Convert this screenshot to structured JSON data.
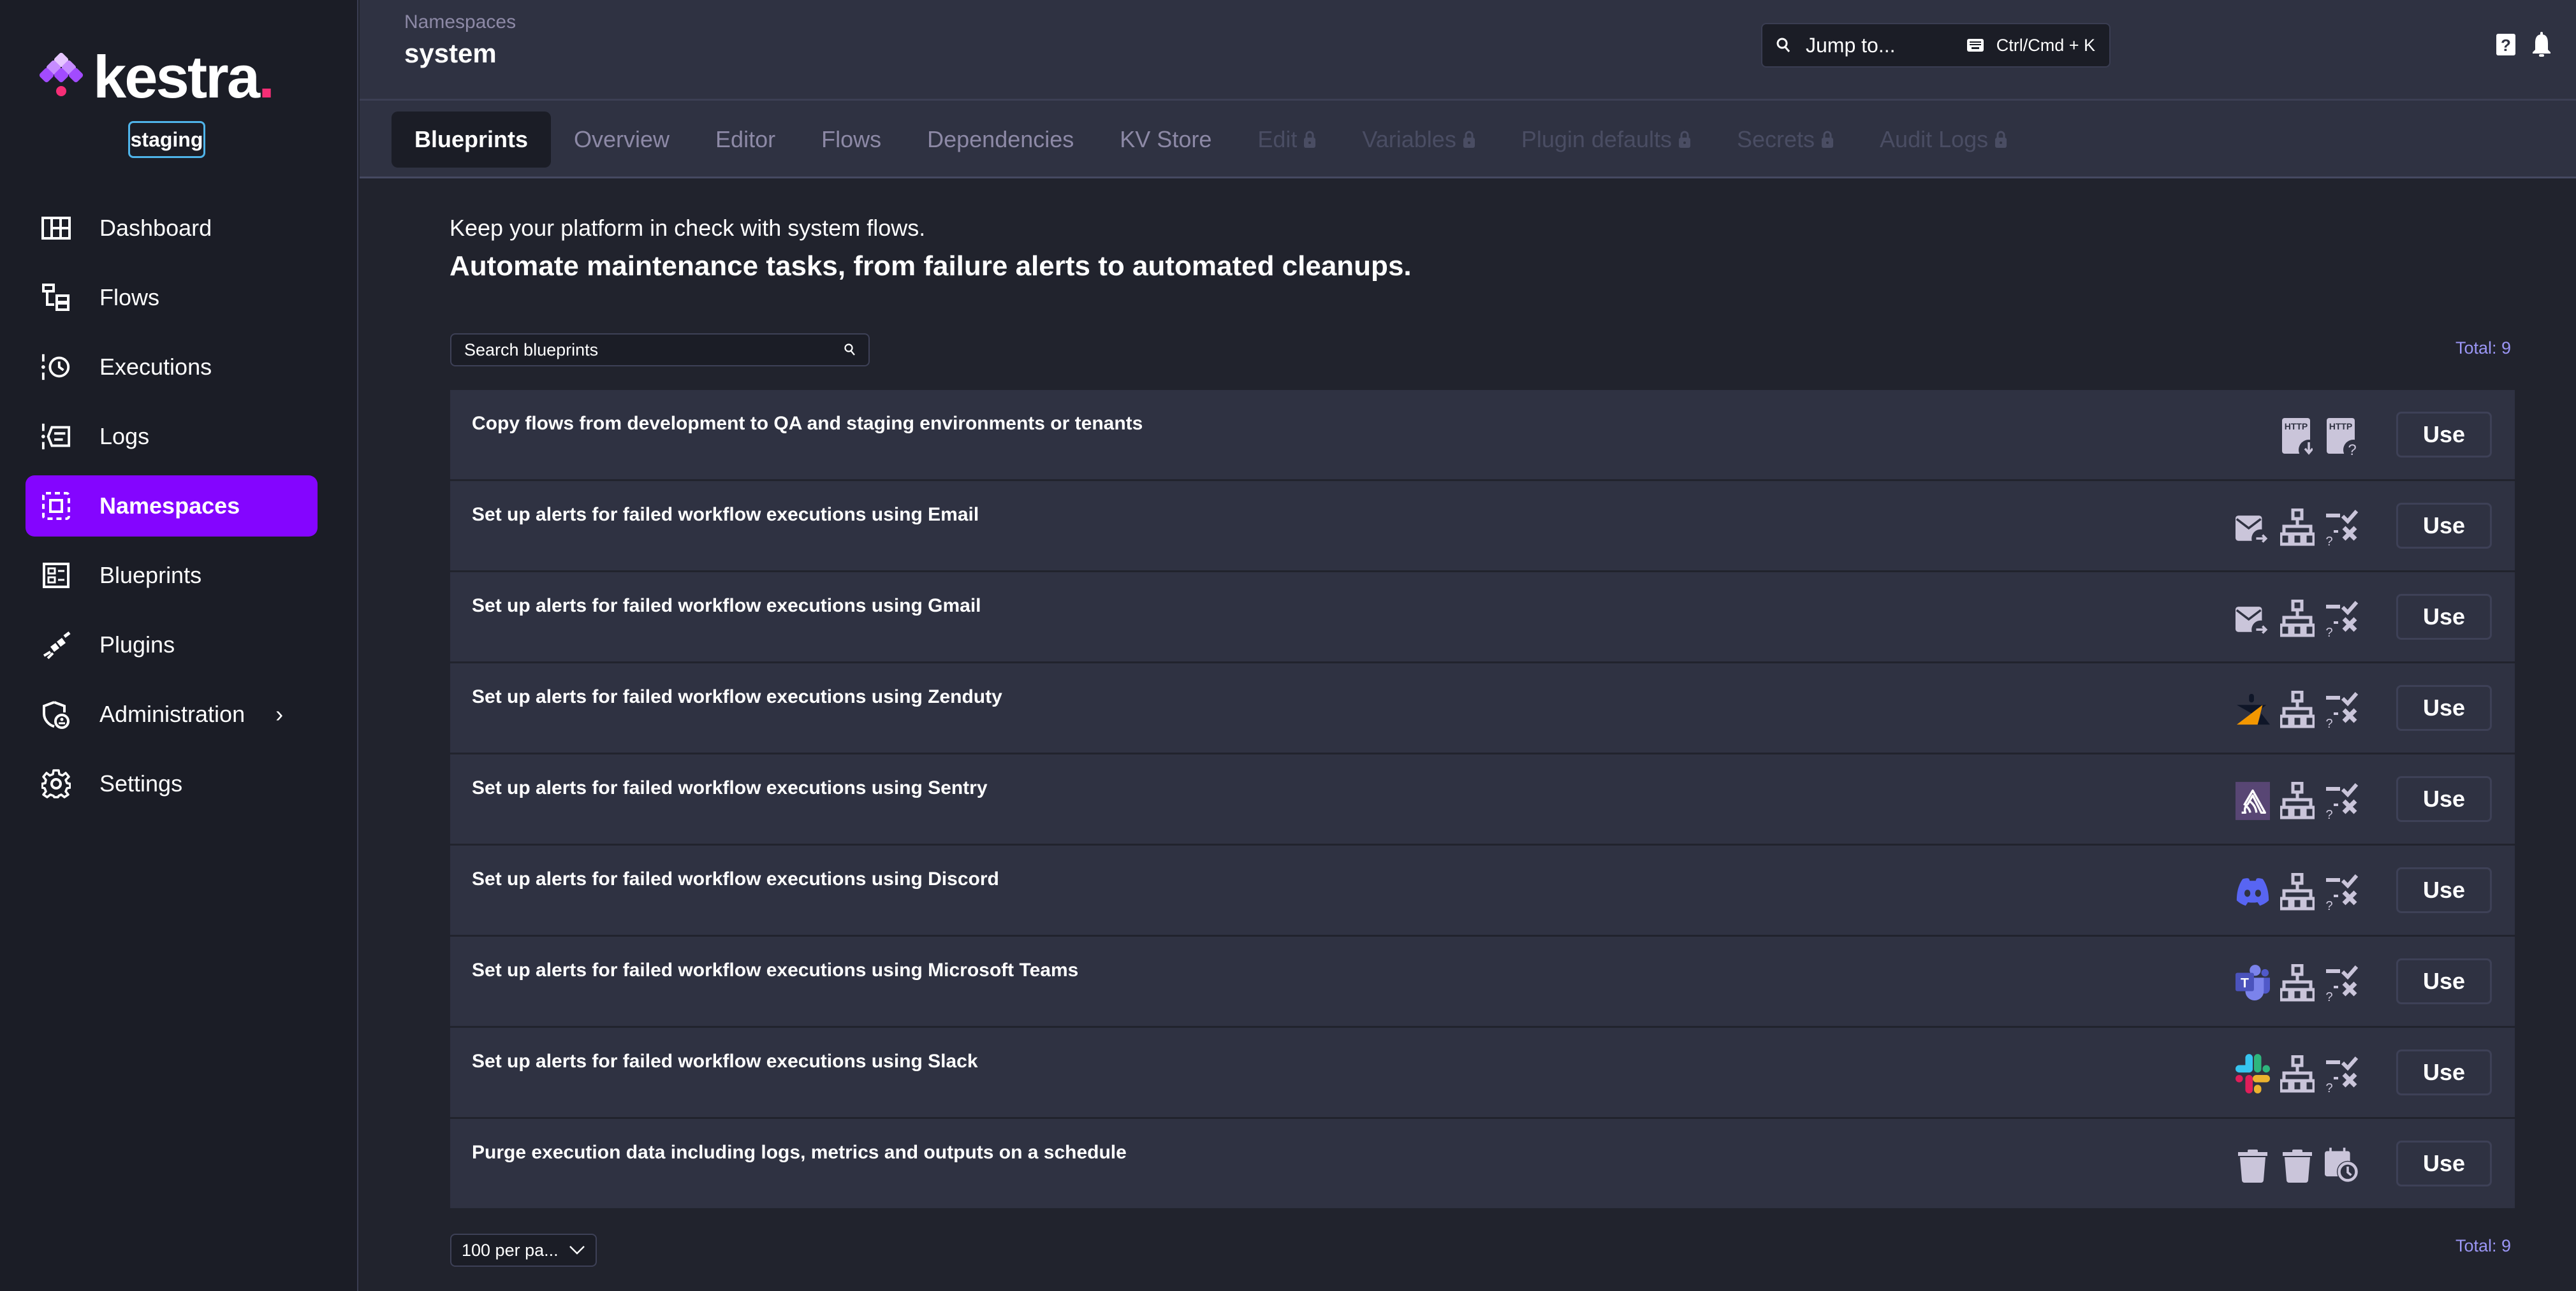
{
  "app": {
    "brand": "kestra",
    "environment": "staging"
  },
  "sidebar": {
    "items": [
      {
        "label": "Dashboard",
        "icon": "dashboard-icon"
      },
      {
        "label": "Flows",
        "icon": "flows-icon"
      },
      {
        "label": "Executions",
        "icon": "executions-icon"
      },
      {
        "label": "Logs",
        "icon": "logs-icon"
      },
      {
        "label": "Namespaces",
        "icon": "namespaces-icon",
        "active": true
      },
      {
        "label": "Blueprints",
        "icon": "blueprints-icon"
      },
      {
        "label": "Plugins",
        "icon": "plugins-icon"
      },
      {
        "label": "Administration",
        "icon": "administration-icon",
        "has_submenu": true
      },
      {
        "label": "Settings",
        "icon": "settings-icon"
      }
    ]
  },
  "header": {
    "breadcrumb": "Namespaces",
    "title": "system",
    "jump_to": {
      "placeholder": "Jump to...",
      "shortcut": "Ctrl/Cmd + K"
    },
    "icons": [
      "help-icon",
      "bell-icon"
    ]
  },
  "tabs": [
    {
      "label": "Blueprints",
      "active": true
    },
    {
      "label": "Overview"
    },
    {
      "label": "Editor"
    },
    {
      "label": "Flows"
    },
    {
      "label": "Dependencies"
    },
    {
      "label": "KV Store"
    },
    {
      "label": "Edit",
      "locked": true
    },
    {
      "label": "Variables",
      "locked": true
    },
    {
      "label": "Plugin defaults",
      "locked": true
    },
    {
      "label": "Secrets",
      "locked": true
    },
    {
      "label": "Audit Logs",
      "locked": true
    }
  ],
  "content": {
    "intro_line": "Keep your platform in check with system flows.",
    "headline": "Automate maintenance tasks, from failure alerts to automated cleanups.",
    "search_placeholder": "Search blueprints",
    "total_label": "Total: 9",
    "use_label": "Use",
    "page_size": "100 per pa..."
  },
  "blueprints": [
    {
      "title": "Copy flows from development to QA and staging environments or tenants",
      "icons": [
        "http-download-icon",
        "http-request-icon"
      ]
    },
    {
      "title": "Set up alerts for failed workflow executions using Email",
      "icons": [
        "email-send-icon",
        "flow-tree-icon",
        "flow-trigger-icon"
      ]
    },
    {
      "title": "Set up alerts for failed workflow executions using Gmail",
      "icons": [
        "email-send-icon",
        "flow-tree-icon",
        "flow-trigger-icon"
      ]
    },
    {
      "title": "Set up alerts for failed workflow executions using Zenduty",
      "icons": [
        "zenduty-icon",
        "flow-tree-icon",
        "flow-trigger-icon"
      ]
    },
    {
      "title": "Set up alerts for failed workflow executions using Sentry",
      "icons": [
        "sentry-icon",
        "flow-tree-icon",
        "flow-trigger-icon"
      ]
    },
    {
      "title": "Set up alerts for failed workflow executions using Discord",
      "icons": [
        "discord-icon",
        "flow-tree-icon",
        "flow-trigger-icon"
      ]
    },
    {
      "title": "Set up alerts for failed workflow executions using Microsoft Teams",
      "icons": [
        "teams-icon",
        "flow-tree-icon",
        "flow-trigger-icon"
      ]
    },
    {
      "title": "Set up alerts for failed workflow executions using Slack",
      "icons": [
        "slack-icon",
        "flow-tree-icon",
        "flow-trigger-icon"
      ]
    },
    {
      "title": "Purge execution data including logs, metrics and outputs on a schedule",
      "icons": [
        "trash-icon",
        "trash-icon",
        "calendar-clock-icon"
      ]
    }
  ],
  "colors": {
    "accent": "#8405ff",
    "brand_dot": "#f62e76",
    "env_border": "#4fb4ea",
    "total_text": "#9b96f5",
    "icon_fill": "#cac5da"
  }
}
